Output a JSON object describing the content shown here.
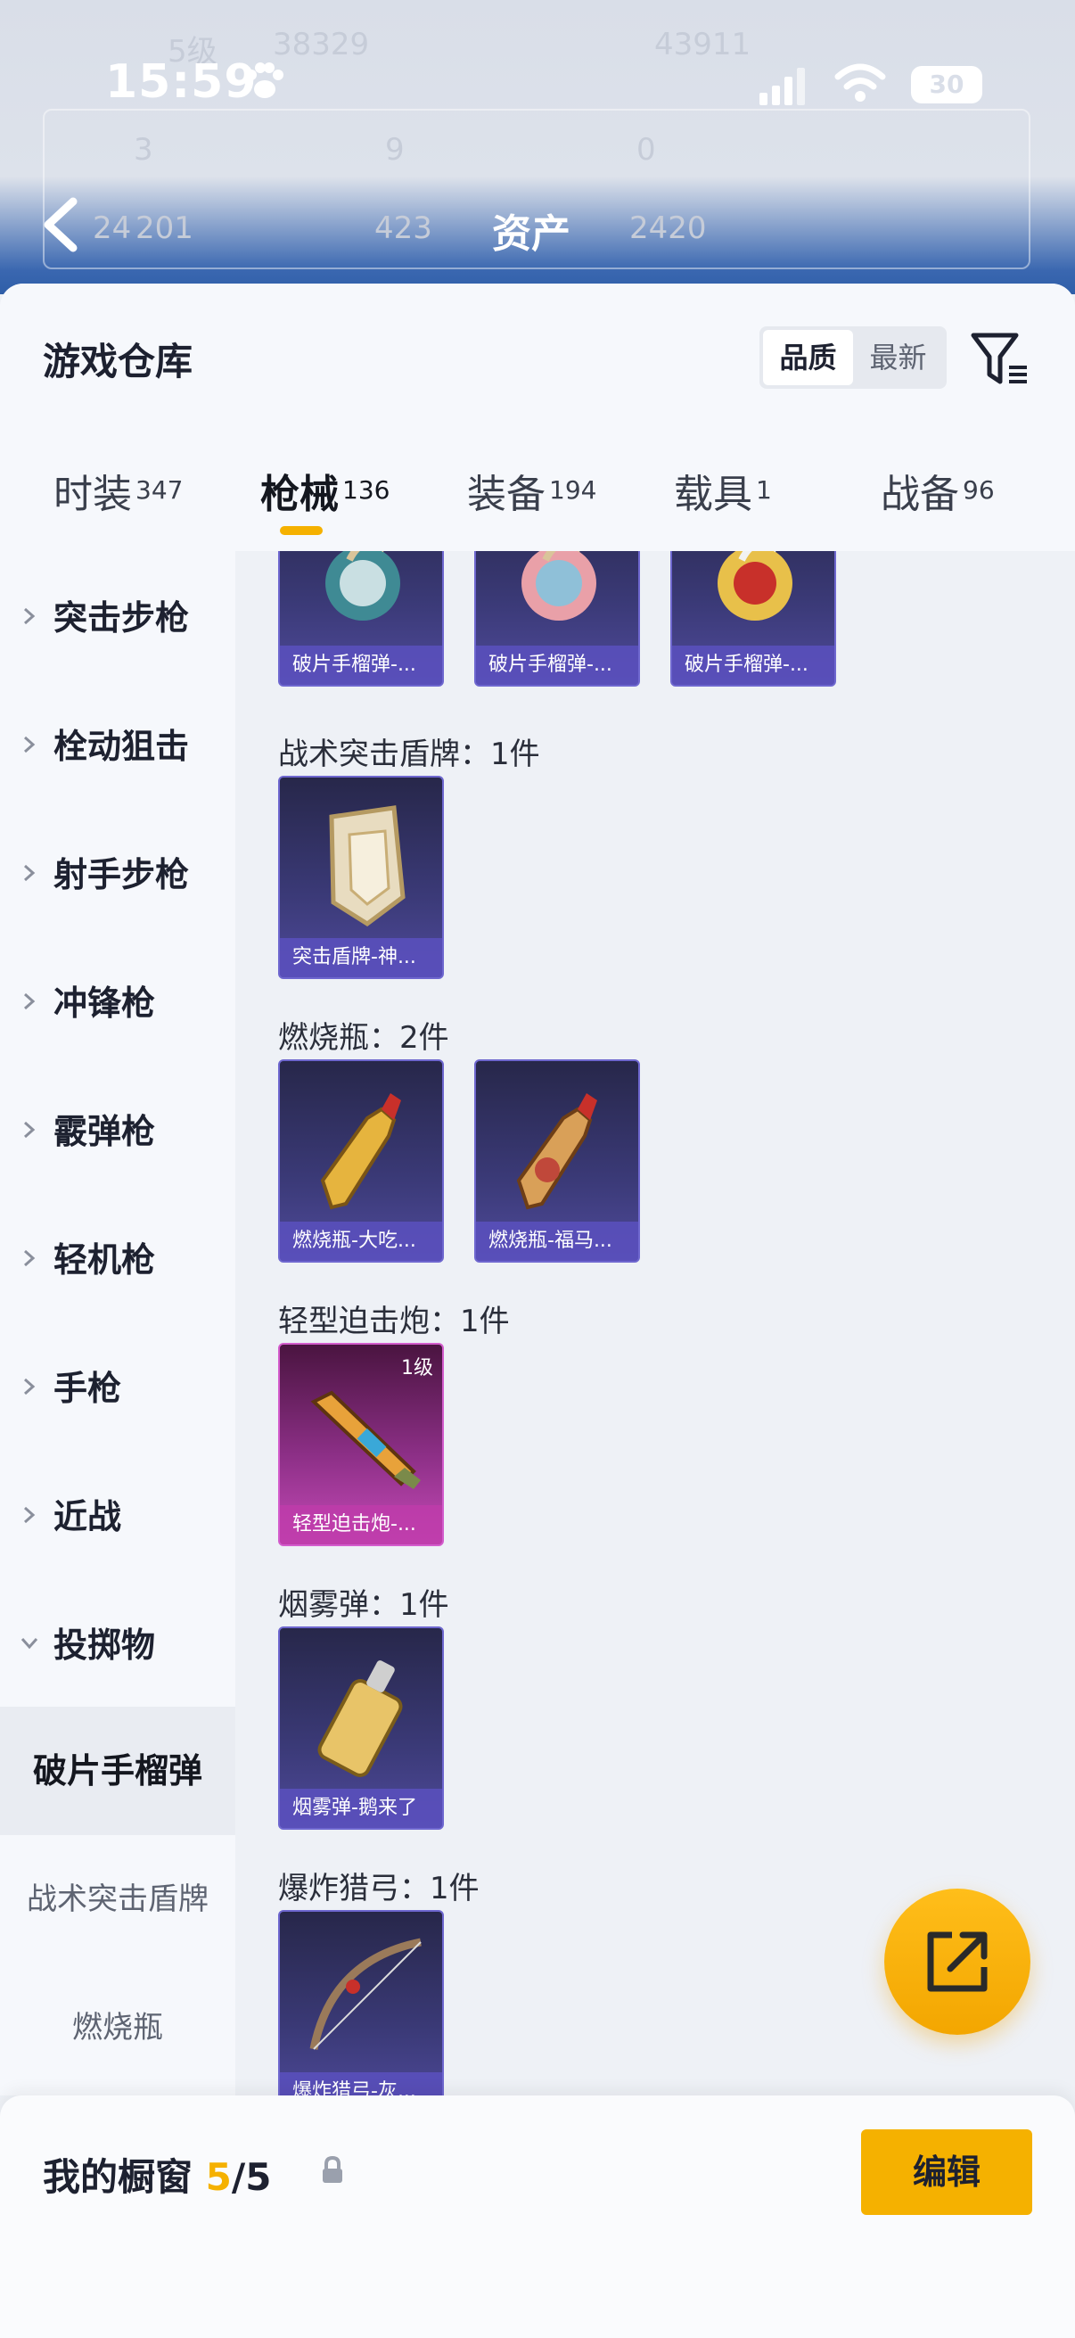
{
  "status_bar": {
    "time": "15:59",
    "battery": "30"
  },
  "top": {
    "title": "资产",
    "ghost_texts": [
      "5级",
      "38329",
      "43911",
      "3",
      "9",
      "0",
      "24",
      "201",
      "423",
      "2420"
    ]
  },
  "sheet": {
    "title": "游戏仓库",
    "sort_options": [
      "品质",
      "最新"
    ],
    "sort_active": "品质"
  },
  "tabs": [
    {
      "label": "时装",
      "count": "347"
    },
    {
      "label": "枪械",
      "count": "136",
      "active": true
    },
    {
      "label": "装备",
      "count": "194"
    },
    {
      "label": "载具",
      "count": "1"
    },
    {
      "label": "战备",
      "count": "96"
    }
  ],
  "sidebar": {
    "categories": [
      "突击步枪",
      "栓动狙击",
      "射手步枪",
      "冲锋枪",
      "霰弹枪",
      "轻机枪",
      "手枪",
      "近战",
      "投掷物"
    ],
    "subcategories": [
      {
        "label": "破片手榴弹",
        "active": true
      },
      {
        "label": "战术突击盾牌"
      },
      {
        "label": "燃烧瓶"
      }
    ]
  },
  "content": {
    "groups": [
      {
        "title": "",
        "items": [
          "破片手榴弹-...",
          "破片手榴弹-...",
          "破片手榴弹-..."
        ]
      },
      {
        "title": "战术突击盾牌：1件",
        "items": [
          "突击盾牌-神..."
        ]
      },
      {
        "title": "燃烧瓶：2件",
        "items": [
          "燃烧瓶-大吃...",
          "燃烧瓶-福马..."
        ]
      },
      {
        "title": "轻型迫击炮：1件",
        "items": [
          "轻型迫击炮-..."
        ],
        "level": "1级"
      },
      {
        "title": "烟雾弹：1件",
        "items": [
          "烟雾弹-鹅来了"
        ]
      },
      {
        "title": "爆炸猎弓：1件",
        "items": [
          "爆炸猎弓-灰..."
        ]
      }
    ]
  },
  "bottom": {
    "label": "我的橱窗",
    "count_current": "5",
    "count_total": "/5",
    "edit_label": "编辑"
  },
  "colors": {
    "accent": "#f5b100",
    "card_purple": "#3b3a78",
    "card_pink": "#8c2f86"
  }
}
